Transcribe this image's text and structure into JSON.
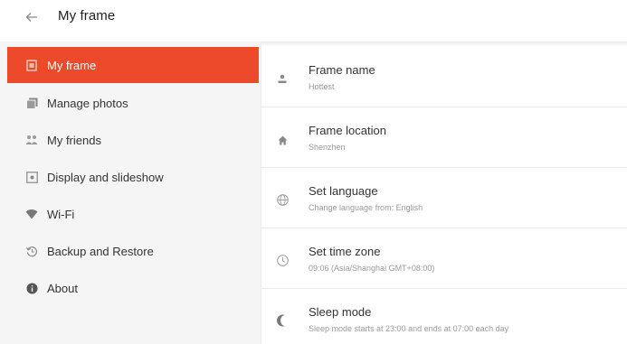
{
  "header": {
    "title": "My frame"
  },
  "sidebar": {
    "items": [
      {
        "label": "My frame",
        "icon": "frame-icon",
        "active": true
      },
      {
        "label": "Manage photos",
        "icon": "photos-icon",
        "active": false
      },
      {
        "label": "My friends",
        "icon": "friends-icon",
        "active": false
      },
      {
        "label": "Display and slideshow",
        "icon": "display-icon",
        "active": false
      },
      {
        "label": "Wi-Fi",
        "icon": "wifi-icon",
        "active": false
      },
      {
        "label": "Backup and Restore",
        "icon": "backup-icon",
        "active": false
      },
      {
        "label": "About",
        "icon": "info-icon",
        "active": false
      }
    ]
  },
  "settings": {
    "rows": [
      {
        "title": "Frame name",
        "subtitle": "Hottest",
        "icon": "person-icon"
      },
      {
        "title": "Frame location",
        "subtitle": "Shenzhen",
        "icon": "home-icon"
      },
      {
        "title": "Set language",
        "subtitle": "Change language from: English",
        "icon": "globe-icon"
      },
      {
        "title": "Set time zone",
        "subtitle": "09:06 (Asia/Shanghai GMT+08:00)",
        "icon": "clock-icon"
      },
      {
        "title": "Sleep mode",
        "subtitle": "Sleep mode starts at 23:00 and ends at 07:00 each day",
        "icon": "moon-icon"
      }
    ]
  },
  "colors": {
    "accent": "#ec4a2b",
    "sidebar_bg": "#f5f5f5"
  }
}
